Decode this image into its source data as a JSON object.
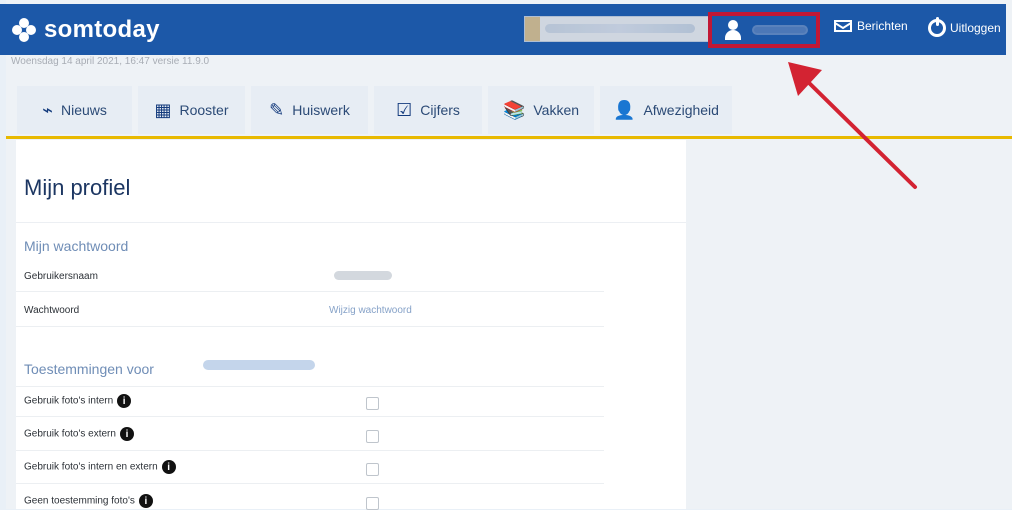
{
  "header": {
    "logo_text": "somtoday",
    "user_button_label": "",
    "messages_label": "Berichten",
    "logout_label": "Uitloggen"
  },
  "meta": {
    "date_version": "Woensdag 14 april 2021, 16:47 versie 11.9.0"
  },
  "tabs": [
    {
      "label": "Nieuws",
      "icon": "rss-icon"
    },
    {
      "label": "Rooster",
      "icon": "calendar-icon"
    },
    {
      "label": "Huiswerk",
      "icon": "pencil-icon"
    },
    {
      "label": "Cijfers",
      "icon": "grade-icon"
    },
    {
      "label": "Vakken",
      "icon": "books-icon"
    },
    {
      "label": "Afwezigheid",
      "icon": "absence-icon"
    }
  ],
  "profile": {
    "title": "Mijn profiel",
    "password_section_title": "Mijn wachtwoord",
    "username_label": "Gebruikersnaam",
    "password_label": "Wachtwoord",
    "password_link": "Wijzig wachtwoord",
    "permissions_title": "Toestemmingen voor",
    "permissions": [
      {
        "label": "Gebruik foto's intern"
      },
      {
        "label": "Gebruik foto's extern"
      },
      {
        "label": "Gebruik foto's intern en extern"
      },
      {
        "label": "Geen toestemming foto's"
      }
    ]
  },
  "colors": {
    "header_blue": "#1c58a8",
    "accent_yellow": "#e8b900",
    "highlight_red": "#c11835"
  }
}
